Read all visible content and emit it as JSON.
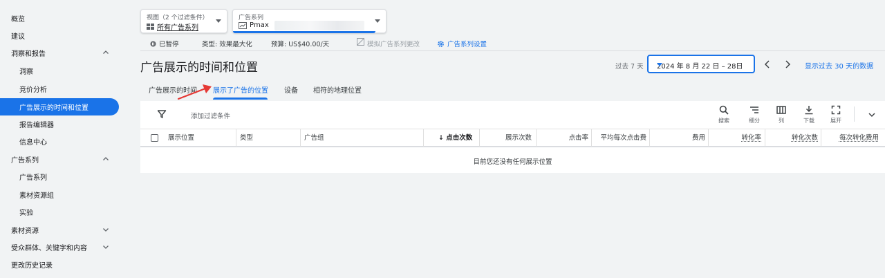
{
  "sidebar": {
    "items": [
      {
        "label": "概览",
        "level": "top"
      },
      {
        "label": "建议",
        "level": "top"
      },
      {
        "label": "洞察和报告",
        "level": "top",
        "chevron": "up"
      },
      {
        "label": "洞察",
        "level": "sub"
      },
      {
        "label": "竞价分析",
        "level": "sub"
      },
      {
        "label": "广告展示的时间和位置",
        "level": "sub",
        "active": true
      },
      {
        "label": "报告编辑器",
        "level": "sub"
      },
      {
        "label": "信息中心",
        "level": "sub"
      },
      {
        "label": "广告系列",
        "level": "top",
        "chevron": "up"
      },
      {
        "label": "广告系列",
        "level": "sub"
      },
      {
        "label": "素材资源组",
        "level": "sub"
      },
      {
        "label": "实验",
        "level": "sub"
      },
      {
        "label": "素材资源",
        "level": "top",
        "chevron": "down"
      },
      {
        "label": "受众群体、关键字和内容",
        "level": "top",
        "chevron": "down"
      },
      {
        "label": "更改历史记录",
        "level": "top"
      }
    ]
  },
  "header": {
    "view_selector": {
      "label": "视图（2 个过滤条件）",
      "value": "所有广告系列"
    },
    "campaign_selector": {
      "label": "广告系列",
      "value": "Pmax"
    },
    "status": {
      "paused": "已暂停",
      "type": "类型:  效果最大化",
      "budget": "预算:  US$40.00/天",
      "simulate": "模拟广告系列更改",
      "settings": "广告系列设置"
    }
  },
  "page": {
    "title": "广告展示的时间和位置",
    "date_range_label": "过去 7 天",
    "date_range_value": "2024 年 8 月 22 日 – 28日",
    "show_30_link": "显示过去 30 天的数据"
  },
  "tabs": [
    {
      "label": "广告展示的时间",
      "active": false
    },
    {
      "label": "展示了广告的位置",
      "active": true
    },
    {
      "label": "设备",
      "active": false
    },
    {
      "label": "相符的地理位置",
      "active": false
    }
  ],
  "toolbar": {
    "filter_placeholder": "添加过滤条件",
    "search": "搜索",
    "segment": "细分",
    "columns": "列",
    "download": "下载",
    "expand": "展开"
  },
  "table": {
    "headers": [
      "展示位置",
      "类型",
      "广告组",
      "点击次数",
      "展示次数",
      "点击率",
      "平均每次点击费",
      "费用",
      "转化率",
      "转化次数",
      "每次转化费用"
    ],
    "sort_indicator": "↓",
    "empty_message": "目前您还没有任何展示位置"
  },
  "colors": {
    "accent": "#1a73e8",
    "annotation_arrow": "#e53935"
  }
}
